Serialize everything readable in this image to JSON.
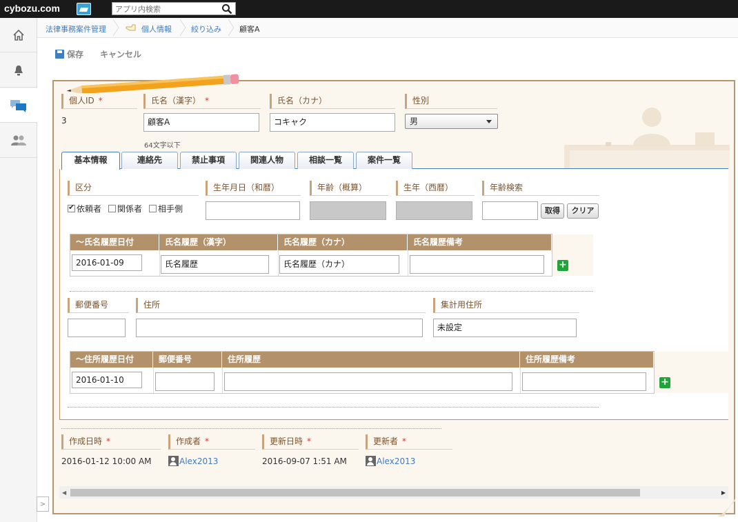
{
  "topbar": {
    "logo": "cybozu.com",
    "search_placeholder": "アプリ内検索"
  },
  "breadcrumb": {
    "items": [
      "法律事務案件管理",
      "個人情報",
      "絞り込み",
      "顧客A"
    ]
  },
  "toolbar": {
    "save_label": "保存",
    "cancel_label": "キャンセル"
  },
  "header_fields": {
    "id_label": "個人ID",
    "id_value": "3",
    "name_kanji_label": "氏名（漢字）",
    "name_kanji_value": "顧客A",
    "name_kanji_hint": "64文字以下",
    "name_kana_label": "氏名（カナ）",
    "name_kana_value": "コキャク",
    "gender_label": "性別",
    "gender_value": "男",
    "required_mark": "*"
  },
  "tabs": [
    "基本情報",
    "連絡先",
    "禁止事項",
    "関連人物",
    "相談一覧",
    "案件一覧"
  ],
  "basic": {
    "category_label": "区分",
    "checkboxes": [
      {
        "label": "依頼者",
        "checked": true
      },
      {
        "label": "関係者",
        "checked": false
      },
      {
        "label": "相手側",
        "checked": false
      }
    ],
    "birth_jp_label": "生年月日（和暦）",
    "age_label": "年齢（概算）",
    "birth_year_label": "生年（西暦）",
    "age_search_label": "年齢検索",
    "get_button": "取得",
    "clear_button": "クリア"
  },
  "name_history": {
    "headers": [
      "〜氏名履歴日付",
      "氏名履歴（漢字）",
      "氏名履歴（カナ）",
      "氏名履歴備考"
    ],
    "row": [
      "2016-01-09",
      "氏名履歴",
      "氏名履歴（カナ）",
      ""
    ],
    "add_label": "+"
  },
  "address": {
    "postal_label": "郵便番号",
    "address_label": "住所",
    "agg_label": "集計用住所",
    "agg_value": "未設定"
  },
  "address_history": {
    "headers": [
      "〜住所履歴日付",
      "郵便番号",
      "住所履歴",
      "住所履歴備考"
    ],
    "row": [
      "2016-01-10",
      "",
      "",
      ""
    ],
    "add_label": "+"
  },
  "meta": {
    "created_at_label": "作成日時",
    "created_at": "2016-01-12 10:00 AM",
    "creator_label": "作成者",
    "creator": "Alex2013",
    "updated_at_label": "更新日時",
    "updated_at": "2016-09-07 1:51 AM",
    "updater_label": "更新者",
    "updater": "Alex2013"
  }
}
